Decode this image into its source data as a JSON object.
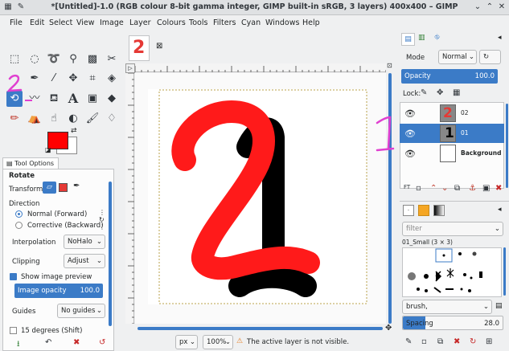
{
  "window": {
    "title": "*[Untitled]-1.0 (RGB colour 8-bit gamma integer, GIMP built-in sRGB, 3 layers) 400x400 – GIMP"
  },
  "menu": [
    "File",
    "Edit",
    "Select",
    "View",
    "Image",
    "Layer",
    "Colours",
    "Tools",
    "Filters",
    "Cyan",
    "Windows",
    "Help"
  ],
  "image_tabs": [
    {
      "thumb_label": "2"
    }
  ],
  "tool_options": {
    "panel_title": "Tool Options",
    "tool_name": "Rotate",
    "transform_label": "Transform:",
    "direction_label": "Direction",
    "direction_options": [
      "Normal (Forward)",
      "Corrective (Backward)"
    ],
    "interpolation_label": "Interpolation",
    "interpolation_value": "NoHalo",
    "clipping_label": "Clipping",
    "clipping_value": "Adjust",
    "show_preview_label": "Show image preview",
    "image_opacity_label": "Image opacity",
    "image_opacity_value": "100.0",
    "guides_label": "Guides",
    "guides_value": "No guides",
    "constraint_label": "15 degrees (Shift)"
  },
  "statusbar": {
    "unit": "px",
    "zoom": "100%",
    "message": "The active layer is not visible."
  },
  "layers_panel": {
    "mode_label": "Mode",
    "mode_value": "Normal",
    "opacity_label": "Opacity",
    "opacity_value": "100.0",
    "lock_label": "Lock:",
    "layers": [
      {
        "name": "02",
        "selected": false
      },
      {
        "name": "01",
        "selected": true
      },
      {
        "name": "Background",
        "selected": false
      }
    ]
  },
  "brushes_panel": {
    "filter_placeholder": "filter",
    "brush_name": "01_Small (3 × 3)",
    "tag_value": "brush,",
    "spacing_label": "Spacing",
    "spacing_value": "28.0"
  },
  "annotations": {
    "toolbox_mark": "2",
    "layers_mark": "1"
  },
  "colors": {
    "foreground": "#ff0000",
    "background": "#ffffff",
    "accent": "#3b7bc7",
    "annotation": "#e040d0"
  }
}
